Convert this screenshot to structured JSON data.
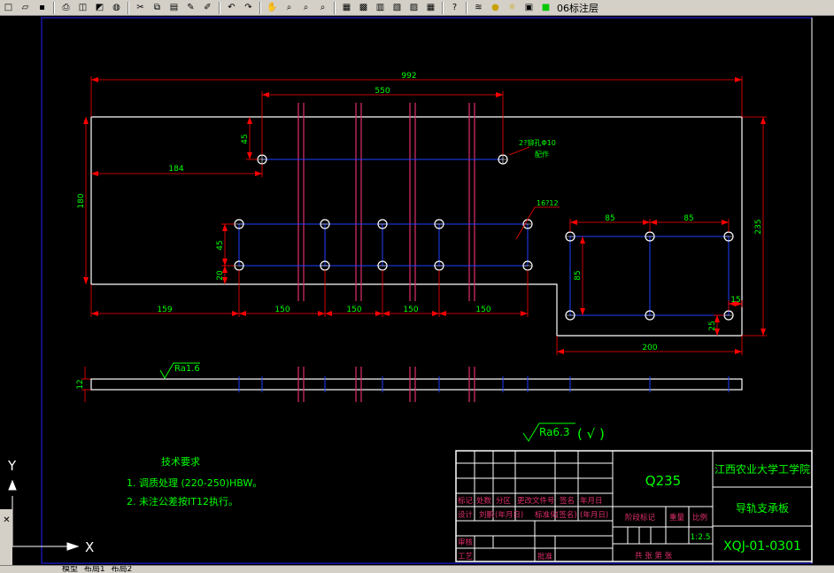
{
  "toolbar": {
    "layer_name": "06标注层"
  },
  "drawing": {
    "dim_overall": "992",
    "dim_550": "550",
    "dim_45_top": "45",
    "dim_184": "184",
    "dim_180": "180",
    "dim_45_mid": "45",
    "dim_20": "20",
    "dim_159": "159",
    "dim_150_1": "150",
    "dim_150_2": "150",
    "dim_150_3": "150",
    "dim_150_4": "150",
    "dim_85_1": "85",
    "dim_85_2": "85",
    "dim_85_v": "85",
    "dim_235": "235",
    "dim_15": "15",
    "dim_25": "25",
    "dim_200": "200",
    "dim_12": "12",
    "note_hole_1": "2?铆孔Φ10",
    "note_hole_2": "配作",
    "note_16holes": "16?12",
    "roughness_side": "Ra1.6",
    "roughness_general": "Ra6.3",
    "roughness_paren": "( √ )"
  },
  "tech_requirements": {
    "title": "技术要求",
    "item1": "1. 调质处理 (220-250)HBW。",
    "item2": "2. 未注公差按IT12执行。"
  },
  "title_block": {
    "material": "Q235",
    "school": "江西农业大学工学院",
    "part_name": "导轨支承板",
    "drawing_no": "XQJ-01-0301",
    "h_mark": "标记",
    "h_count": "处数",
    "h_zone": "分区",
    "h_change_doc": "更改文件号",
    "h_sign": "签名",
    "h_date": "年月日",
    "h_design": "设计",
    "h_designer": "刘鹏",
    "h_date_paren": "(年月日)",
    "h_standard": "标准化",
    "h_sign_paren": "(签名)",
    "h_date_paren2": "(年月日)",
    "h_stage": "阶段标记",
    "h_weight": "重量",
    "h_scale": "比例",
    "scale": "1:2.5",
    "h_review": "审核",
    "h_process": "工艺",
    "h_approve": "批准",
    "sheets": "共  张 第  张"
  },
  "ucs": {
    "y": "Y",
    "x": "X"
  },
  "tabs": {
    "model": "模型",
    "layout1": "布局1",
    "layout2": "布局2"
  }
}
